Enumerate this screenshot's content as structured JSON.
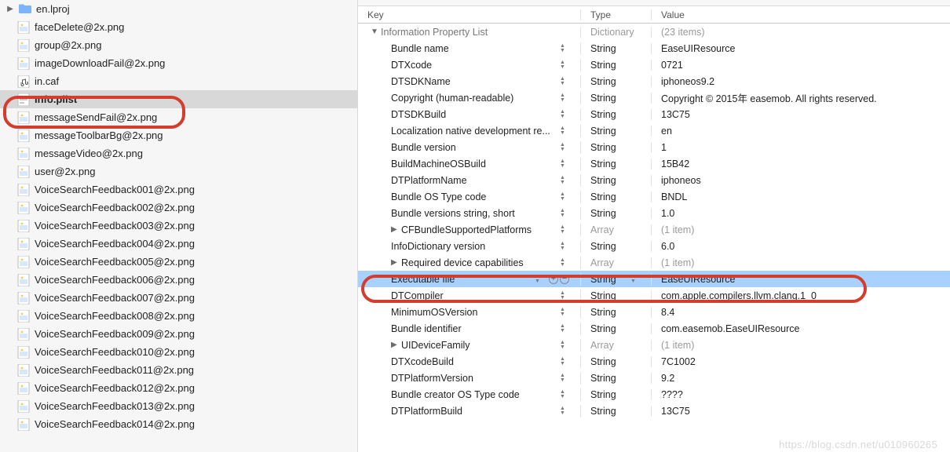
{
  "sidebar": {
    "files": [
      {
        "name": "en.lproj",
        "kind": "folder"
      },
      {
        "name": "faceDelete@2x.png",
        "kind": "png"
      },
      {
        "name": "group@2x.png",
        "kind": "png"
      },
      {
        "name": "imageDownloadFail@2x.png",
        "kind": "png"
      },
      {
        "name": "in.caf",
        "kind": "audio"
      },
      {
        "name": "Info.plist",
        "kind": "plist",
        "selected": true
      },
      {
        "name": "messageSendFail@2x.png",
        "kind": "png"
      },
      {
        "name": "messageToolbarBg@2x.png",
        "kind": "png"
      },
      {
        "name": "messageVideo@2x.png",
        "kind": "png"
      },
      {
        "name": "user@2x.png",
        "kind": "png"
      },
      {
        "name": "VoiceSearchFeedback001@2x.png",
        "kind": "png"
      },
      {
        "name": "VoiceSearchFeedback002@2x.png",
        "kind": "png"
      },
      {
        "name": "VoiceSearchFeedback003@2x.png",
        "kind": "png"
      },
      {
        "name": "VoiceSearchFeedback004@2x.png",
        "kind": "png"
      },
      {
        "name": "VoiceSearchFeedback005@2x.png",
        "kind": "png"
      },
      {
        "name": "VoiceSearchFeedback006@2x.png",
        "kind": "png"
      },
      {
        "name": "VoiceSearchFeedback007@2x.png",
        "kind": "png"
      },
      {
        "name": "VoiceSearchFeedback008@2x.png",
        "kind": "png"
      },
      {
        "name": "VoiceSearchFeedback009@2x.png",
        "kind": "png"
      },
      {
        "name": "VoiceSearchFeedback010@2x.png",
        "kind": "png"
      },
      {
        "name": "VoiceSearchFeedback011@2x.png",
        "kind": "png"
      },
      {
        "name": "VoiceSearchFeedback012@2x.png",
        "kind": "png"
      },
      {
        "name": "VoiceSearchFeedback013@2x.png",
        "kind": "png"
      },
      {
        "name": "VoiceSearchFeedback014@2x.png",
        "kind": "png"
      }
    ]
  },
  "plist": {
    "header": {
      "key": "Key",
      "type": "Type",
      "value": "Value"
    },
    "root": {
      "key": "Information Property List",
      "type": "Dictionary",
      "value": "(23 items)"
    },
    "rows": [
      {
        "key": "Bundle name",
        "type": "String",
        "value": "EaseUIResource"
      },
      {
        "key": "DTXcode",
        "type": "String",
        "value": "0721"
      },
      {
        "key": "DTSDKName",
        "type": "String",
        "value": "iphoneos9.2"
      },
      {
        "key": "Copyright (human-readable)",
        "type": "String",
        "value": "Copyright © 2015年 easemob. All rights reserved."
      },
      {
        "key": "DTSDKBuild",
        "type": "String",
        "value": "13C75"
      },
      {
        "key": "Localization native development re...",
        "type": "String",
        "value": "en"
      },
      {
        "key": "Bundle version",
        "type": "String",
        "value": "1"
      },
      {
        "key": "BuildMachineOSBuild",
        "type": "String",
        "value": "15B42"
      },
      {
        "key": "DTPlatformName",
        "type": "String",
        "value": "iphoneos"
      },
      {
        "key": "Bundle OS Type code",
        "type": "String",
        "value": "BNDL"
      },
      {
        "key": "Bundle versions string, short",
        "type": "String",
        "value": "1.0"
      },
      {
        "key": "CFBundleSupportedPlatforms",
        "type": "Array",
        "value": "(1 item)",
        "arrow": true,
        "muted": true
      },
      {
        "key": "InfoDictionary version",
        "type": "String",
        "value": "6.0"
      },
      {
        "key": "Required device capabilities",
        "type": "Array",
        "value": "(1 item)",
        "arrow": true,
        "muted": true
      },
      {
        "key": "Executable file",
        "type": "String",
        "value": "EaseUIResource",
        "selected": true
      },
      {
        "key": "DTCompiler",
        "type": "String",
        "value": "com.apple.compilers.llvm.clang.1_0"
      },
      {
        "key": "MinimumOSVersion",
        "type": "String",
        "value": "8.4"
      },
      {
        "key": "Bundle identifier",
        "type": "String",
        "value": "com.easemob.EaseUIResource"
      },
      {
        "key": "UIDeviceFamily",
        "type": "Array",
        "value": "(1 item)",
        "arrow": true,
        "muted": true
      },
      {
        "key": "DTXcodeBuild",
        "type": "String",
        "value": "7C1002"
      },
      {
        "key": "DTPlatformVersion",
        "type": "String",
        "value": "9.2"
      },
      {
        "key": "Bundle creator OS Type code",
        "type": "String",
        "value": "????"
      },
      {
        "key": "DTPlatformBuild",
        "type": "String",
        "value": "13C75"
      }
    ]
  },
  "watermark": "https://blog.csdn.net/u010960265"
}
